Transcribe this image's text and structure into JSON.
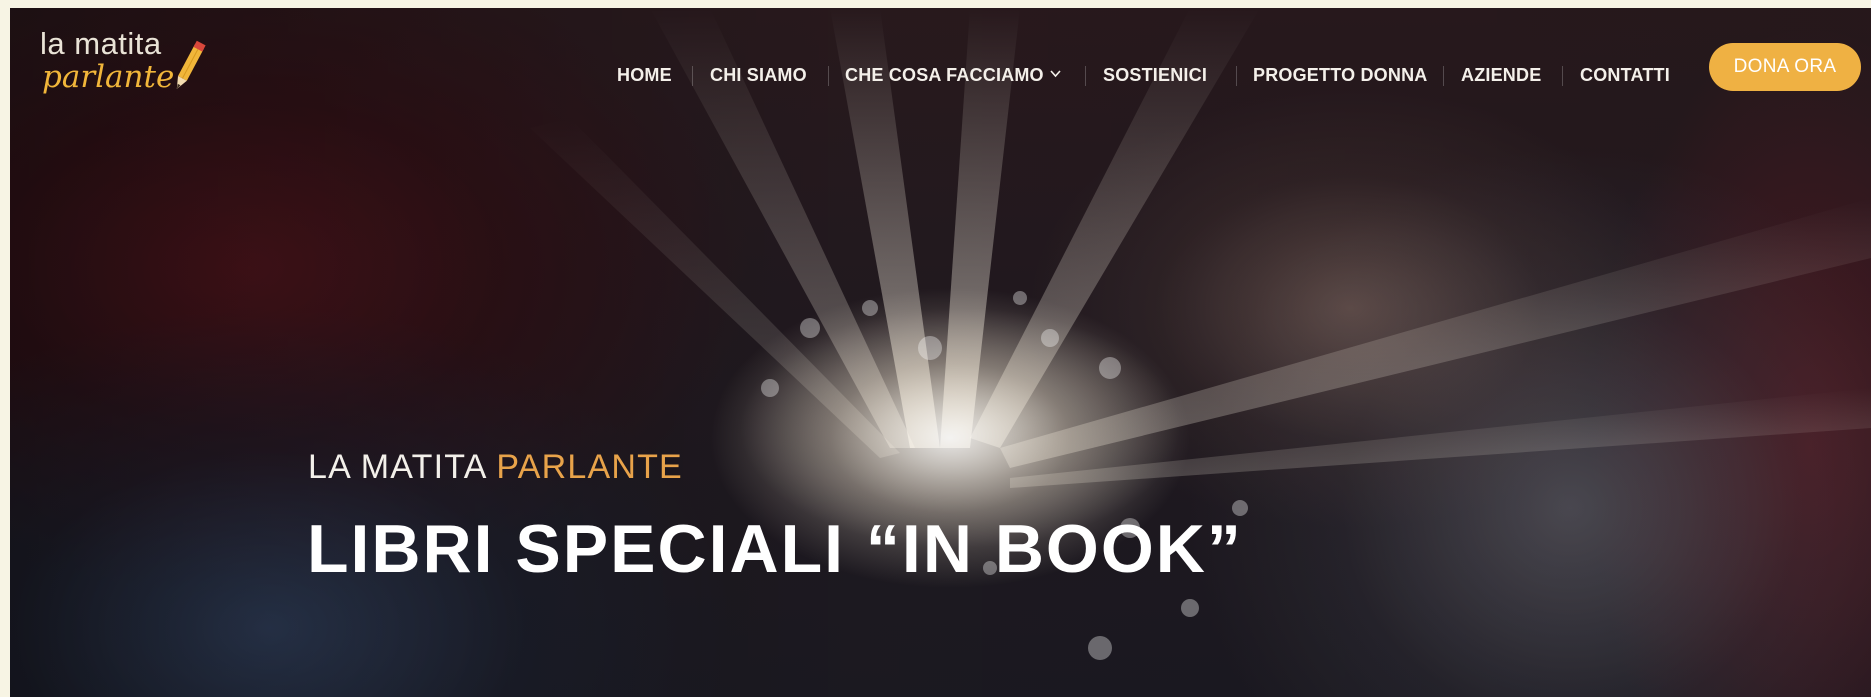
{
  "logo": {
    "line1": "la matita",
    "line2": "parlante"
  },
  "nav": {
    "items": [
      {
        "label": "HOME"
      },
      {
        "label": "CHI SIAMO"
      },
      {
        "label": "CHE COSA FACCIAMO",
        "has_dropdown": true
      },
      {
        "label": "SOSTIENICI"
      },
      {
        "label": "PROGETTO DONNA"
      },
      {
        "label": "AZIENDE"
      },
      {
        "label": "CONTATTI"
      }
    ],
    "cta_label": "DONA ORA"
  },
  "hero": {
    "kicker_main": "LA MATITA",
    "kicker_accent": "PARLANTE",
    "title": "LIBRI SPECIALI “IN BOOK”"
  },
  "colors": {
    "accent": "#efb143",
    "kicker_accent": "#e8a34a",
    "page_background": "#f7f4e4",
    "text_light": "#f4f0ea"
  },
  "icons": {
    "dropdown": "chevron-down-icon",
    "logo_pencil": "pencil-icon"
  }
}
